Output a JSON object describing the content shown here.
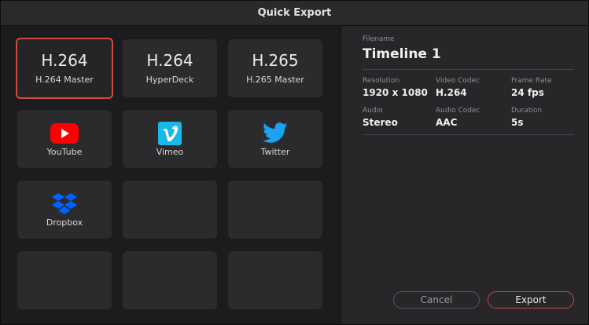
{
  "window": {
    "title": "Quick Export"
  },
  "presets": [
    {
      "big": "H.264",
      "label": "H.264 Master",
      "selected": true
    },
    {
      "big": "H.264",
      "label": "HyperDeck"
    },
    {
      "big": "H.265",
      "label": "H.265 Master"
    },
    {
      "icon": "youtube-icon",
      "label": "YouTube"
    },
    {
      "icon": "vimeo-icon",
      "label": "Vimeo"
    },
    {
      "icon": "twitter-icon",
      "label": "Twitter"
    },
    {
      "icon": "dropbox-icon",
      "label": "Dropbox"
    }
  ],
  "details": {
    "filename_label": "Filename",
    "filename": "Timeline 1",
    "resolution_label": "Resolution",
    "resolution": "1920 x 1080",
    "video_codec_label": "Video Codec",
    "video_codec": "H.264",
    "frame_rate_label": "Frame Rate",
    "frame_rate": "24 fps",
    "audio_label": "Audio",
    "audio": "Stereo",
    "audio_codec_label": "Audio Codec",
    "audio_codec": "AAC",
    "duration_label": "Duration",
    "duration": "5s"
  },
  "buttons": {
    "cancel": "Cancel",
    "export": "Export"
  },
  "colors": {
    "accent": "#d24a3c",
    "youtube": "#ff0000",
    "vimeo": "#1ab7ea",
    "twitter": "#1da1f2",
    "dropbox": "#0061fe"
  }
}
